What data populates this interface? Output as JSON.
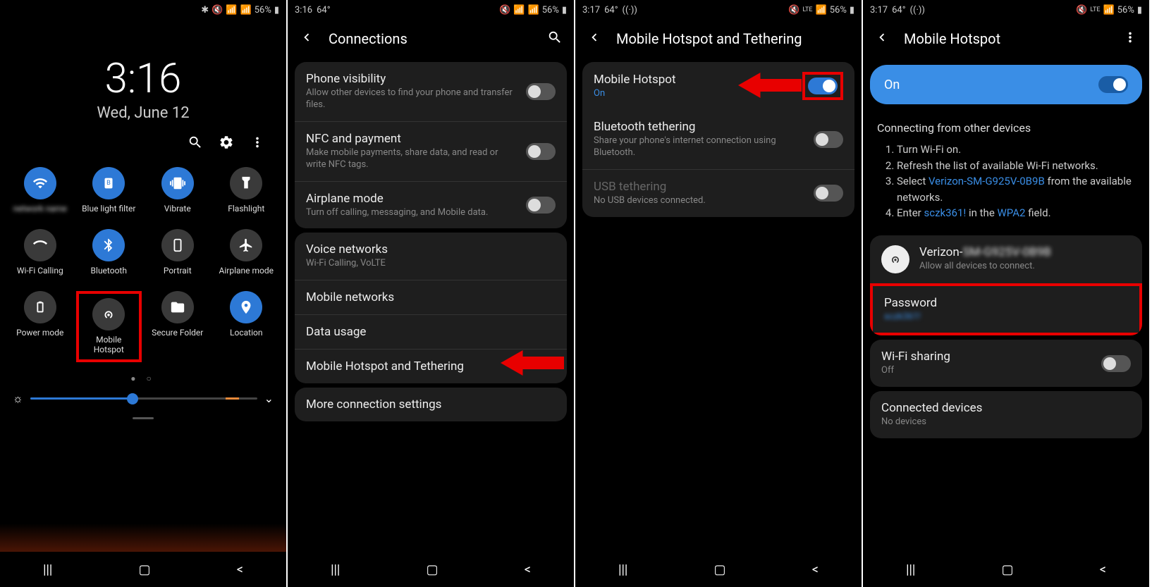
{
  "screen1": {
    "status": {
      "battery": "56%"
    },
    "time": "3:16",
    "date": "Wed, June 12",
    "tiles": [
      {
        "label": "",
        "active": true,
        "icon": "wifi",
        "blur": true
      },
      {
        "label": "Blue light filter",
        "active": true,
        "icon": "bluelight"
      },
      {
        "label": "Vibrate",
        "active": true,
        "icon": "vibrate"
      },
      {
        "label": "Flashlight",
        "active": false,
        "icon": "flashlight"
      },
      {
        "label": "Wi-Fi Calling",
        "active": false,
        "icon": "wificall"
      },
      {
        "label": "Bluetooth",
        "active": true,
        "icon": "bluetooth"
      },
      {
        "label": "Portrait",
        "active": false,
        "icon": "portrait"
      },
      {
        "label": "Airplane mode",
        "active": false,
        "icon": "airplane"
      },
      {
        "label": "Power mode",
        "active": false,
        "icon": "power"
      },
      {
        "label": "Mobile Hotspot",
        "active": false,
        "icon": "hotspot",
        "highlight": true
      },
      {
        "label": "Secure Folder",
        "active": false,
        "icon": "folder"
      },
      {
        "label": "Location",
        "active": true,
        "icon": "location"
      }
    ]
  },
  "screen2": {
    "status": {
      "time": "3:16",
      "temp": "64°",
      "battery": "56%"
    },
    "title": "Connections",
    "g1": [
      {
        "t": "Phone visibility",
        "s": "Allow other devices to find your phone and transfer files.",
        "toggle": true
      },
      {
        "t": "NFC and payment",
        "s": "Make mobile payments, share data, and read or write NFC tags.",
        "toggle": true
      },
      {
        "t": "Airplane mode",
        "s": "Turn off calling, messaging, and Mobile data.",
        "toggle": true
      }
    ],
    "g2": [
      {
        "t": "Voice networks",
        "s": "Wi-Fi Calling, VoLTE"
      },
      {
        "t": "Mobile networks"
      },
      {
        "t": "Data usage"
      },
      {
        "t": "Mobile Hotspot and Tethering",
        "arrow": true
      }
    ],
    "g3": [
      {
        "t": "More connection settings"
      }
    ]
  },
  "screen3": {
    "status": {
      "time": "3:17",
      "temp": "64°",
      "battery": "56%"
    },
    "title": "Mobile Hotspot and Tethering",
    "rows": [
      {
        "t": "Mobile Hotspot",
        "s": "On",
        "blue": true,
        "toggle": true,
        "on": true,
        "arrow": true,
        "tHighlight": true
      },
      {
        "t": "Bluetooth tethering",
        "s": "Share your phone's internet connection using Bluetooth.",
        "toggle": true
      },
      {
        "t": "USB tethering",
        "s": "No USB devices connected.",
        "toggle": true,
        "dim": true
      }
    ]
  },
  "screen4": {
    "status": {
      "time": "3:17",
      "temp": "64°",
      "battery": "56%"
    },
    "title": "Mobile Hotspot",
    "onLabel": "On",
    "instrTitle": "Connecting from other devices",
    "steps": [
      "Turn Wi-Fi on.",
      "Refresh the list of available Wi-Fi networks.",
      "Select <a>Verizon-SM-G925V-0B9B</a> from the available networks.",
      "Enter <a>sczk361!</a> in the <a>WPA2</a> field."
    ],
    "net": {
      "name": "Verizon-",
      "sub": "Allow all devices to connect."
    },
    "pwd": {
      "t": "Password",
      "s": "sczk361!"
    },
    "wifishare": {
      "t": "Wi-Fi sharing",
      "s": "Off"
    },
    "conn": {
      "t": "Connected devices",
      "s": "No devices"
    }
  }
}
